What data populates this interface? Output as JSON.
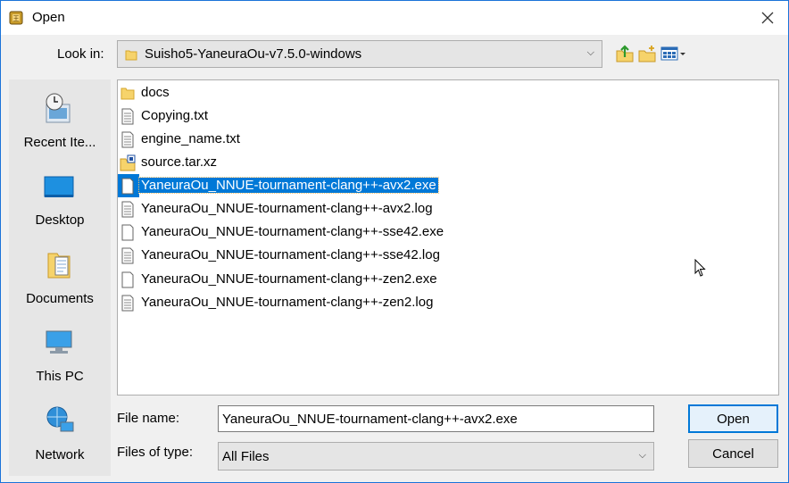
{
  "window": {
    "title": "Open"
  },
  "look_in": {
    "label": "Look in:",
    "value": "Suisho5-YaneuraOu-v7.5.0-windows"
  },
  "toolbar": {
    "up_icon": "up-one-level-icon",
    "new_folder_icon": "new-folder-icon",
    "view_icon": "view-menu-icon"
  },
  "places": [
    {
      "label": "Recent Ite...",
      "icon": "recent-items-icon"
    },
    {
      "label": "Desktop",
      "icon": "desktop-icon"
    },
    {
      "label": "Documents",
      "icon": "documents-icon"
    },
    {
      "label": "This PC",
      "icon": "this-pc-icon"
    },
    {
      "label": "Network",
      "icon": "network-icon"
    }
  ],
  "files": [
    {
      "name": "docs",
      "icon": "folder-icon"
    },
    {
      "name": "Copying.txt",
      "icon": "text-file-icon"
    },
    {
      "name": "engine_name.txt",
      "icon": "text-file-icon"
    },
    {
      "name": "source.tar.xz",
      "icon": "archive-icon"
    },
    {
      "name": "YaneuraOu_NNUE-tournament-clang++-avx2.exe",
      "icon": "exe-file-icon",
      "selected": true
    },
    {
      "name": "YaneuraOu_NNUE-tournament-clang++-avx2.log",
      "icon": "text-file-icon"
    },
    {
      "name": "YaneuraOu_NNUE-tournament-clang++-sse42.exe",
      "icon": "exe-file-icon"
    },
    {
      "name": "YaneuraOu_NNUE-tournament-clang++-sse42.log",
      "icon": "text-file-icon"
    },
    {
      "name": "YaneuraOu_NNUE-tournament-clang++-zen2.exe",
      "icon": "exe-file-icon"
    },
    {
      "name": "YaneuraOu_NNUE-tournament-clang++-zen2.log",
      "icon": "text-file-icon"
    }
  ],
  "file_name": {
    "label": "File name:",
    "value": "YaneuraOu_NNUE-tournament-clang++-avx2.exe"
  },
  "file_type": {
    "label": "Files of type:",
    "value": "All Files"
  },
  "buttons": {
    "open": "Open",
    "cancel": "Cancel"
  },
  "colors": {
    "selection": "#0078d7",
    "accent": "#0078d7"
  }
}
